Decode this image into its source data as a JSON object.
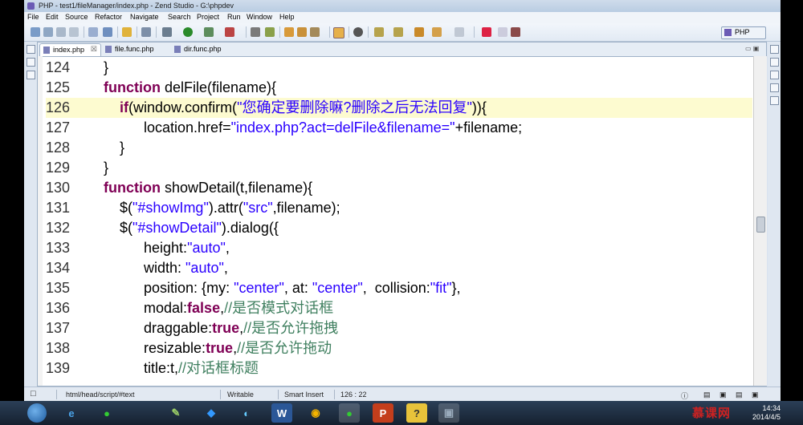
{
  "window": {
    "title": "PHP - test1/fileManager/index.php - Zend Studio - G:\\phpdev"
  },
  "menu": [
    "File",
    "Edit",
    "Source",
    "Refactor",
    "Navigate",
    "Search",
    "Project",
    "Run",
    "Window",
    "Help"
  ],
  "perspective": {
    "label": "PHP"
  },
  "tabs": [
    {
      "label": "index.php",
      "active": true,
      "close": "☒"
    },
    {
      "label": "file.func.php",
      "active": false
    },
    {
      "label": "dir.func.php",
      "active": false
    }
  ],
  "editor": {
    "current_line": 126,
    "lines": [
      {
        "num": "124",
        "tokens": [
          {
            "t": "    }",
            "c": ""
          }
        ]
      },
      {
        "num": "125",
        "tokens": [
          {
            "t": "    ",
            "c": ""
          },
          {
            "t": "function",
            "c": "kw"
          },
          {
            "t": " delFile(filename){",
            "c": ""
          }
        ]
      },
      {
        "num": "126",
        "tokens": [
          {
            "t": "        ",
            "c": ""
          },
          {
            "t": "if",
            "c": "kw"
          },
          {
            "t": "(window.confirm(",
            "c": ""
          },
          {
            "t": "\"您确定要删除嘛?删除之后无法回复\"",
            "c": "str"
          },
          {
            "t": ")){",
            "c": ""
          }
        ]
      },
      {
        "num": "127",
        "tokens": [
          {
            "t": "              location.href=",
            "c": ""
          },
          {
            "t": "\"index.php?act=delFile&filename=\"",
            "c": "str"
          },
          {
            "t": "+filename;",
            "c": ""
          }
        ]
      },
      {
        "num": "128",
        "tokens": [
          {
            "t": "        }",
            "c": ""
          }
        ]
      },
      {
        "num": "129",
        "tokens": [
          {
            "t": "    }",
            "c": ""
          }
        ]
      },
      {
        "num": "130",
        "tokens": [
          {
            "t": "    ",
            "c": ""
          },
          {
            "t": "function",
            "c": "kw"
          },
          {
            "t": " showDetail(t,filename){",
            "c": ""
          }
        ]
      },
      {
        "num": "131",
        "tokens": [
          {
            "t": "        $(",
            "c": ""
          },
          {
            "t": "\"#showImg\"",
            "c": "str"
          },
          {
            "t": ").attr(",
            "c": ""
          },
          {
            "t": "\"src\"",
            "c": "str"
          },
          {
            "t": ",filename);",
            "c": ""
          }
        ]
      },
      {
        "num": "132",
        "tokens": [
          {
            "t": "        $(",
            "c": ""
          },
          {
            "t": "\"#showDetail\"",
            "c": "str"
          },
          {
            "t": ").dialog({",
            "c": ""
          }
        ]
      },
      {
        "num": "133",
        "tokens": [
          {
            "t": "              height:",
            "c": ""
          },
          {
            "t": "\"auto\"",
            "c": "str"
          },
          {
            "t": ",",
            "c": ""
          }
        ]
      },
      {
        "num": "134",
        "tokens": [
          {
            "t": "              width: ",
            "c": ""
          },
          {
            "t": "\"auto\"",
            "c": "str"
          },
          {
            "t": ",",
            "c": ""
          }
        ]
      },
      {
        "num": "135",
        "tokens": [
          {
            "t": "              position: {my: ",
            "c": ""
          },
          {
            "t": "\"center\"",
            "c": "str"
          },
          {
            "t": ", at: ",
            "c": ""
          },
          {
            "t": "\"center\"",
            "c": "str"
          },
          {
            "t": ",  collision:",
            "c": ""
          },
          {
            "t": "\"fit\"",
            "c": "str"
          },
          {
            "t": "},",
            "c": ""
          }
        ]
      },
      {
        "num": "136",
        "tokens": [
          {
            "t": "              modal:",
            "c": ""
          },
          {
            "t": "false",
            "c": "kw"
          },
          {
            "t": ",",
            "c": ""
          },
          {
            "t": "//是否模式对话框",
            "c": "cmt"
          }
        ]
      },
      {
        "num": "137",
        "tokens": [
          {
            "t": "              draggable:",
            "c": ""
          },
          {
            "t": "true",
            "c": "kw"
          },
          {
            "t": ",",
            "c": ""
          },
          {
            "t": "//是否允许拖拽",
            "c": "cmt"
          }
        ]
      },
      {
        "num": "138",
        "tokens": [
          {
            "t": "              resizable:",
            "c": ""
          },
          {
            "t": "true",
            "c": "kw"
          },
          {
            "t": ",",
            "c": ""
          },
          {
            "t": "//是否允许拖动",
            "c": "cmt"
          }
        ]
      },
      {
        "num": "139",
        "tokens": [
          {
            "t": "              title:t,",
            "c": ""
          },
          {
            "t": "//对话框标题",
            "c": "cmt"
          }
        ]
      }
    ]
  },
  "status": {
    "path": "html/head/script/#text",
    "mode": "Writable",
    "insert": "Smart Insert",
    "position": "126 : 22"
  },
  "taskbar": {
    "time": "14:34",
    "date": "2014/4/5",
    "apps": [
      "e",
      "●",
      "✎",
      "◆",
      "◐",
      "W",
      "◉",
      "●",
      "P",
      "?",
      "▣"
    ]
  },
  "watermark": "慕课网",
  "colors": {
    "keyword": "#7f0055",
    "string": "#2a00ff",
    "comment": "#3f7f5f",
    "current_line": "#fdfbd0"
  }
}
